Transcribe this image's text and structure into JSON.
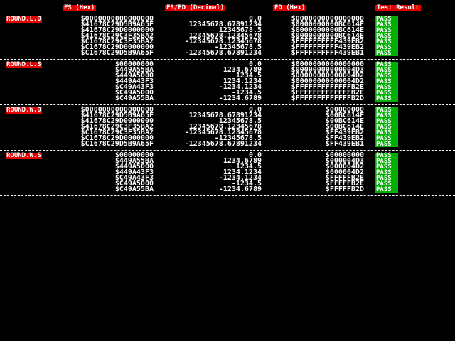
{
  "headers": {
    "fs_hex": "FS (Hex)",
    "fs_fd_dec": "FS/FD (Decimal)",
    "fd_hex": "FD (Hex)",
    "result": "Test Result"
  },
  "sections": [
    {
      "label": "ROUND.L.D",
      "rows": [
        {
          "fs": "$0000000000000000",
          "dec": "0.0",
          "fd": "$0000000000000000",
          "res": "PASS"
        },
        {
          "fs": "$41678C29D5B9A65F",
          "dec": "12345678.67891234",
          "fd": "$0000000000BC614F",
          "res": "PASS"
        },
        {
          "fs": "$41678C29D0000000",
          "dec": "12345678.5",
          "fd": "$0000000000BC614E",
          "res": "PASS"
        },
        {
          "fs": "$41678C29C3F35BA2",
          "dec": "12345678.12345678",
          "fd": "$0000000000BC614E",
          "res": "PASS"
        },
        {
          "fs": "$C1678C29C3F35BA2",
          "dec": "-12345678.12345678",
          "fd": "$FFFFFFFFFF439EB2",
          "res": "PASS"
        },
        {
          "fs": "$C1678C29D0000000",
          "dec": "-12345678.5",
          "fd": "$FFFFFFFFFF439EB2",
          "res": "PASS"
        },
        {
          "fs": "$C1678C29D5B9A65F",
          "dec": "-12345678.67891234",
          "fd": "$FFFFFFFFFF439EB1",
          "res": "PASS"
        }
      ]
    },
    {
      "label": "ROUND.L.S",
      "rows": [
        {
          "fs": "$00000000",
          "dec": "0.0",
          "fd": "$0000000000000000",
          "res": "PASS"
        },
        {
          "fs": "$449A55BA",
          "dec": "1234.6789",
          "fd": "$00000000000004D3",
          "res": "PASS"
        },
        {
          "fs": "$449A5000",
          "dec": "1234.5",
          "fd": "$00000000000004D2",
          "res": "PASS"
        },
        {
          "fs": "$449A43F3",
          "dec": "1234.1234",
          "fd": "$00000000000004D2",
          "res": "PASS"
        },
        {
          "fs": "$C49A43F3",
          "dec": "-1234.1234",
          "fd": "$FFFFFFFFFFFFFB2E",
          "res": "PASS"
        },
        {
          "fs": "$C49A5000",
          "dec": "-1234.5",
          "fd": "$FFFFFFFFFFFFFB2E",
          "res": "PASS"
        },
        {
          "fs": "$C49A55BA",
          "dec": "-1234.6789",
          "fd": "$FFFFFFFFFFFFFB2D",
          "res": "PASS"
        }
      ]
    },
    {
      "label": "ROUND.W.D",
      "rows": [
        {
          "fs": "$0000000000000000",
          "dec": "0.0",
          "fd": "$00000000",
          "res": "PASS"
        },
        {
          "fs": "$41678C29D5B9A65F",
          "dec": "12345678.67891234",
          "fd": "$00BC614F",
          "res": "PASS"
        },
        {
          "fs": "$41678C29D0000000",
          "dec": "12345678.5",
          "fd": "$00BC614E",
          "res": "PASS"
        },
        {
          "fs": "$41678C29C3F35BA2",
          "dec": "12345678.12345678",
          "fd": "$00BC614E",
          "res": "PASS"
        },
        {
          "fs": "$C1678C29C3F35BA2",
          "dec": "-12345678.12345678",
          "fd": "$FF439EB2",
          "res": "PASS"
        },
        {
          "fs": "$C1678C29D0000000",
          "dec": "-12345678.5",
          "fd": "$FF439EB2",
          "res": "PASS"
        },
        {
          "fs": "$C1678C29D5B9A65F",
          "dec": "-12345678.67891234",
          "fd": "$FF439EB1",
          "res": "PASS"
        }
      ]
    },
    {
      "label": "ROUND.W.S",
      "rows": [
        {
          "fs": "$00000000",
          "dec": "0.0",
          "fd": "$00000000",
          "res": "PASS"
        },
        {
          "fs": "$449A55BA",
          "dec": "1234.6789",
          "fd": "$000004D3",
          "res": "PASS"
        },
        {
          "fs": "$449A5000",
          "dec": "1234.5",
          "fd": "$000004D2",
          "res": "PASS"
        },
        {
          "fs": "$449A43F3",
          "dec": "1234.1234",
          "fd": "$000004D2",
          "res": "PASS"
        },
        {
          "fs": "$C49A43F3",
          "dec": "-1234.1234",
          "fd": "$FFFFFB2E",
          "res": "PASS"
        },
        {
          "fs": "$C49A5000",
          "dec": "-1234.5",
          "fd": "$FFFFFB2E",
          "res": "PASS"
        },
        {
          "fs": "$C49A55BA",
          "dec": "-1234.6789",
          "fd": "$FFFFFB2D",
          "res": "PASS"
        }
      ]
    }
  ]
}
